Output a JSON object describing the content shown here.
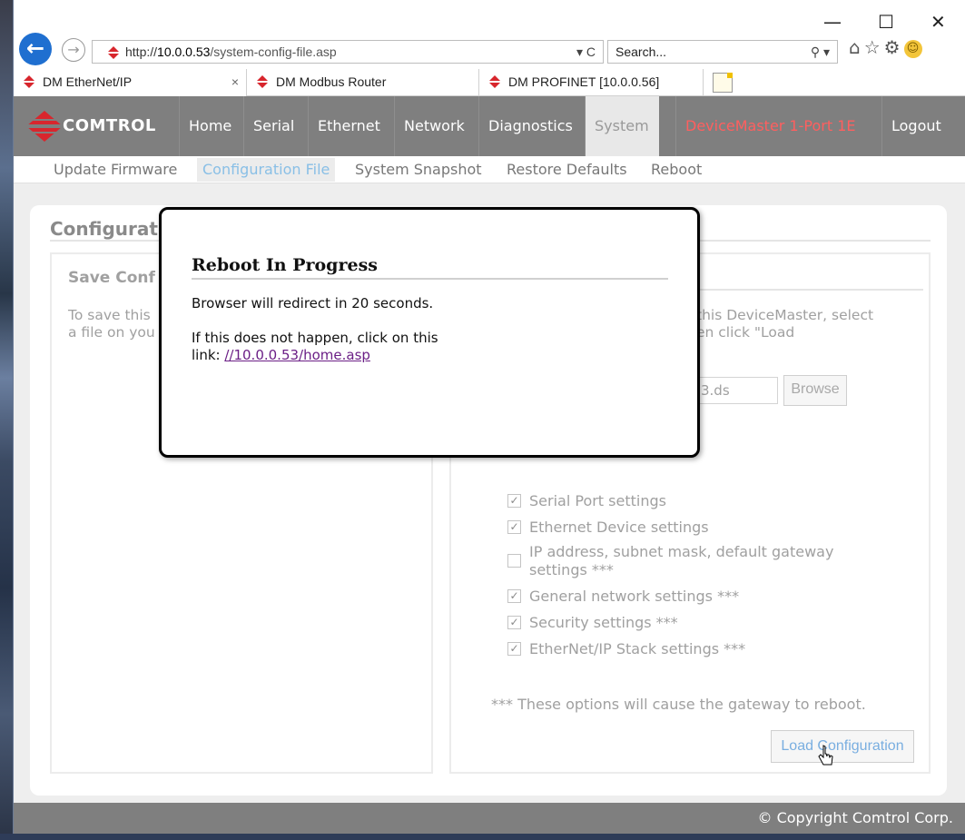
{
  "window": {
    "minimize": "—",
    "maximize": "☐",
    "close": "✕"
  },
  "address_bar": {
    "url_prefix": "http://",
    "url_host": "10.0.0.53",
    "url_path": "/system-config-file.asp",
    "controls": "▾ C"
  },
  "search_box": {
    "placeholder": "Search...",
    "controls": "⚲ ▾"
  },
  "tabs": [
    {
      "label": "DM EtherNet/IP",
      "close": "×"
    },
    {
      "label": "DM Modbus Router"
    },
    {
      "label": "DM PROFINET [10.0.0.56]"
    }
  ],
  "site": {
    "logo_text": "Comtrol",
    "nav": [
      "Home",
      "Serial",
      "Ethernet",
      "Network",
      "Diagnostics",
      "System"
    ],
    "device_name": "DeviceMaster 1-Port 1E",
    "logout": "Logout",
    "subnav": [
      "Update Firmware",
      "Configuration File",
      "System Snapshot",
      "Restore Defaults",
      "Reboot"
    ]
  },
  "page": {
    "title": "Configurat",
    "save_box": {
      "title": "Save Conf",
      "text_line1": "To save this",
      "text_line2": "a file on you"
    },
    "load_box": {
      "text_line1": "this DeviceMaster, select",
      "text_line2": "en click \"Load",
      "file_value": "3.ds",
      "browse_label": "Browse",
      "checkboxes": [
        {
          "label": "Serial Port settings",
          "checked": true
        },
        {
          "label": "Ethernet Device settings",
          "checked": true
        },
        {
          "label": "IP address, subnet mask, default gateway settings ***",
          "checked": false
        },
        {
          "label": "General network settings ***",
          "checked": true
        },
        {
          "label": "Security settings ***",
          "checked": true
        },
        {
          "label": "EtherNet/IP Stack settings ***",
          "checked": true
        }
      ],
      "reboot_note": "*** These options will cause the gateway to reboot.",
      "load_button": "Load Configuration"
    }
  },
  "footer": {
    "copyright": "© Copyright Comtrol Corp."
  },
  "modal": {
    "title": "Reboot In Progress",
    "line1": "Browser will redirect in 20 seconds.",
    "line2": "If this does not happen, click on this",
    "line3_prefix": "link: ",
    "link": "//10.0.0.53/home.asp"
  },
  "colors": {
    "nav_bg": "#7f7f7f",
    "device_name": "#ff5f5f",
    "link": "#6b1f86",
    "active_sub": "#89bfe6"
  }
}
